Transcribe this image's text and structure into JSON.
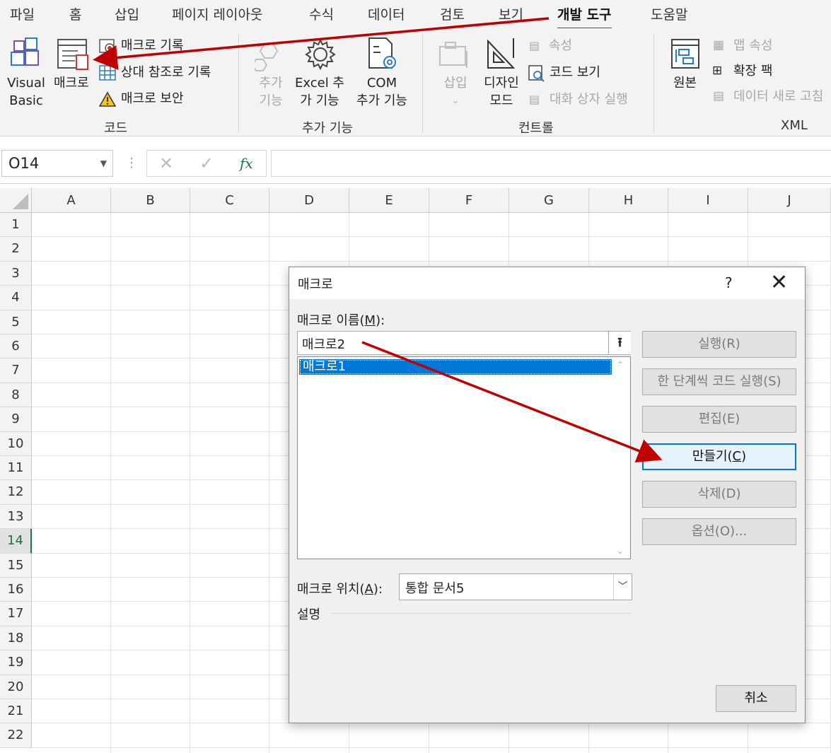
{
  "tabs": [
    "파일",
    "홈",
    "삽입",
    "페이지 레이아웃",
    "수식",
    "데이터",
    "검토",
    "보기",
    "개발 도구",
    "도움말"
  ],
  "ribbon": {
    "code_group": {
      "visual_basic_line1": "Visual",
      "visual_basic_line2": "Basic",
      "macro": "매크로",
      "record_macro": "매크로 기록",
      "relative_ref": "상대 참조로 기록",
      "macro_security": "매크로 보안",
      "label": "코드"
    },
    "addins_group": {
      "addins_line1": "추가",
      "addins_line2": "기능",
      "excel_addins_line1": "Excel 추",
      "excel_addins_line2": "가 기능",
      "com_addins_line1": "COM",
      "com_addins_line2": "추가 기능",
      "label": "추가 기능"
    },
    "controls_group": {
      "insert": "삽입",
      "design_mode_line1": "디자인",
      "design_mode_line2": "모드",
      "properties": "속성",
      "view_code": "코드 보기",
      "run_dialog": "대화 상자 실행",
      "label": "컨트롤"
    },
    "xml_group": {
      "source": "원본",
      "map_properties": "맵 속성",
      "expansion_packs": "확장 팩",
      "refresh_data": "데이터 새로 고침",
      "label": "XML"
    }
  },
  "formula_bar": {
    "name_box": "O14",
    "fx": "fx"
  },
  "grid": {
    "columns": [
      "A",
      "B",
      "C",
      "D",
      "E",
      "F",
      "G",
      "H",
      "I",
      "J"
    ],
    "rows": [
      "1",
      "2",
      "3",
      "4",
      "5",
      "6",
      "7",
      "8",
      "9",
      "10",
      "11",
      "12",
      "13",
      "14",
      "15",
      "16",
      "17",
      "18",
      "19",
      "20",
      "21",
      "22"
    ],
    "selected_row": "14"
  },
  "dialog": {
    "title": "매크로",
    "help": "?",
    "close": "✕",
    "name_label_prefix": "매크로 이름(",
    "name_label_key": "M",
    "name_label_suffix": "):",
    "name_value": "매크로2",
    "list_items": [
      "매크로1"
    ],
    "buttons": {
      "run": "실행(R)",
      "step_into": "한 단계씩 코드 실행(S)",
      "edit": "편집(E)",
      "create_prefix": "만들기(",
      "create_key": "C",
      "create_suffix": ")",
      "delete": "삭제(D)",
      "options": "옵션(O)...",
      "cancel": "취소"
    },
    "location_label_prefix": "매크로 위치(",
    "location_label_key": "A",
    "location_label_suffix": "):",
    "location_value": "통합 문서5",
    "description_label": "설명"
  },
  "colors": {
    "accent_green": "#1e7145",
    "selection_blue": "#0078d7",
    "annotation_red": "#c00000"
  }
}
